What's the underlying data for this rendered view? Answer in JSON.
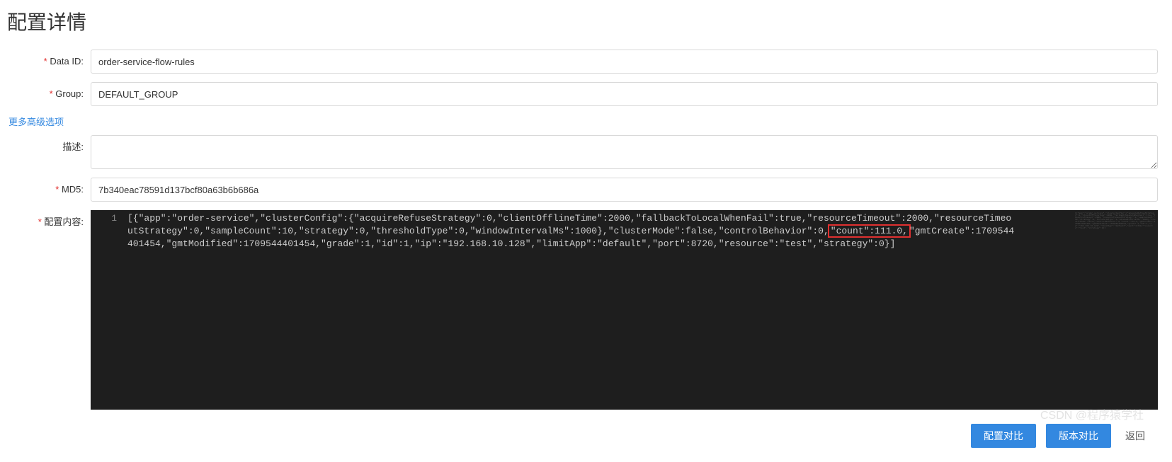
{
  "page": {
    "title": "配置详情"
  },
  "labels": {
    "data_id": "Data ID:",
    "group": "Group:",
    "desc": "描述:",
    "md5": "MD5:",
    "content": "配置内容:",
    "advanced_link": "更多高级选项"
  },
  "fields": {
    "data_id": "order-service-flow-rules",
    "group": "DEFAULT_GROUP",
    "desc": "",
    "md5": "7b340eac78591d137bcf80a63b6b686a"
  },
  "editor": {
    "line_number": "1",
    "code_pre": "[{\"app\":\"order-service\",\"clusterConfig\":{\"acquireRefuseStrategy\":0,\"clientOfflineTime\":2000,\"fallbackToLocalWhenFail\":true,\"resourceTimeout\":2000,\"resourceTimeoutStrategy\":0,\"sampleCount\":10,\"strategy\":0,\"thresholdType\":0,\"windowIntervalMs\":1000},\"clusterMode\":false,\"controlBehavior\":0,",
    "code_hi": "\"count\":111.0,",
    "code_post": "\"gmtCreate\":1709544401454,\"gmtModified\":1709544401454,\"grade\":1,\"id\":1,\"ip\":\"192.168.10.128\",\"limitApp\":\"default\",\"port\":8720,\"resource\":\"test\",\"strategy\":0}]"
  },
  "buttons": {
    "config_compare": "配置对比",
    "version_compare": "版本对比",
    "back": "返回"
  },
  "watermark": "CSDN @程序猿学社"
}
